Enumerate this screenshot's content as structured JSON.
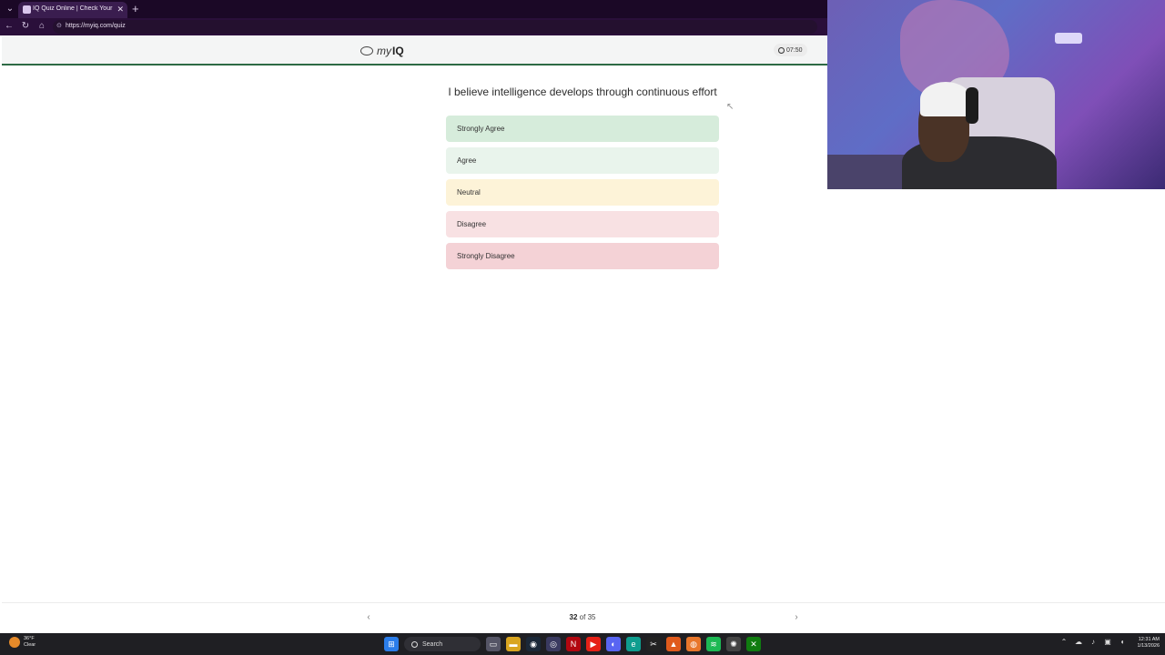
{
  "browser": {
    "tab_title": "IQ Quiz Online | Check Your IQ Sc",
    "url": "https://myiq.com/quiz"
  },
  "header": {
    "logo_my": "my",
    "logo_iq": "IQ",
    "timer": "07:50"
  },
  "quiz": {
    "question": "I believe intelligence develops through continuous effort",
    "options": [
      {
        "label": "Strongly Agree",
        "color": "#d6ecdb"
      },
      {
        "label": "Agree",
        "color": "#e9f4ec"
      },
      {
        "label": "Neutral",
        "color": "#fdf3d8"
      },
      {
        "label": "Disagree",
        "color": "#f8e1e3"
      },
      {
        "label": "Strongly Disagree",
        "color": "#f4d2d6"
      }
    ]
  },
  "footer": {
    "current": "32",
    "of_text": "of 35"
  },
  "taskbar": {
    "temperature": "36°F",
    "condition": "Clear",
    "search": "Search",
    "time": "12:31 AM",
    "date": "1/13/2026"
  }
}
